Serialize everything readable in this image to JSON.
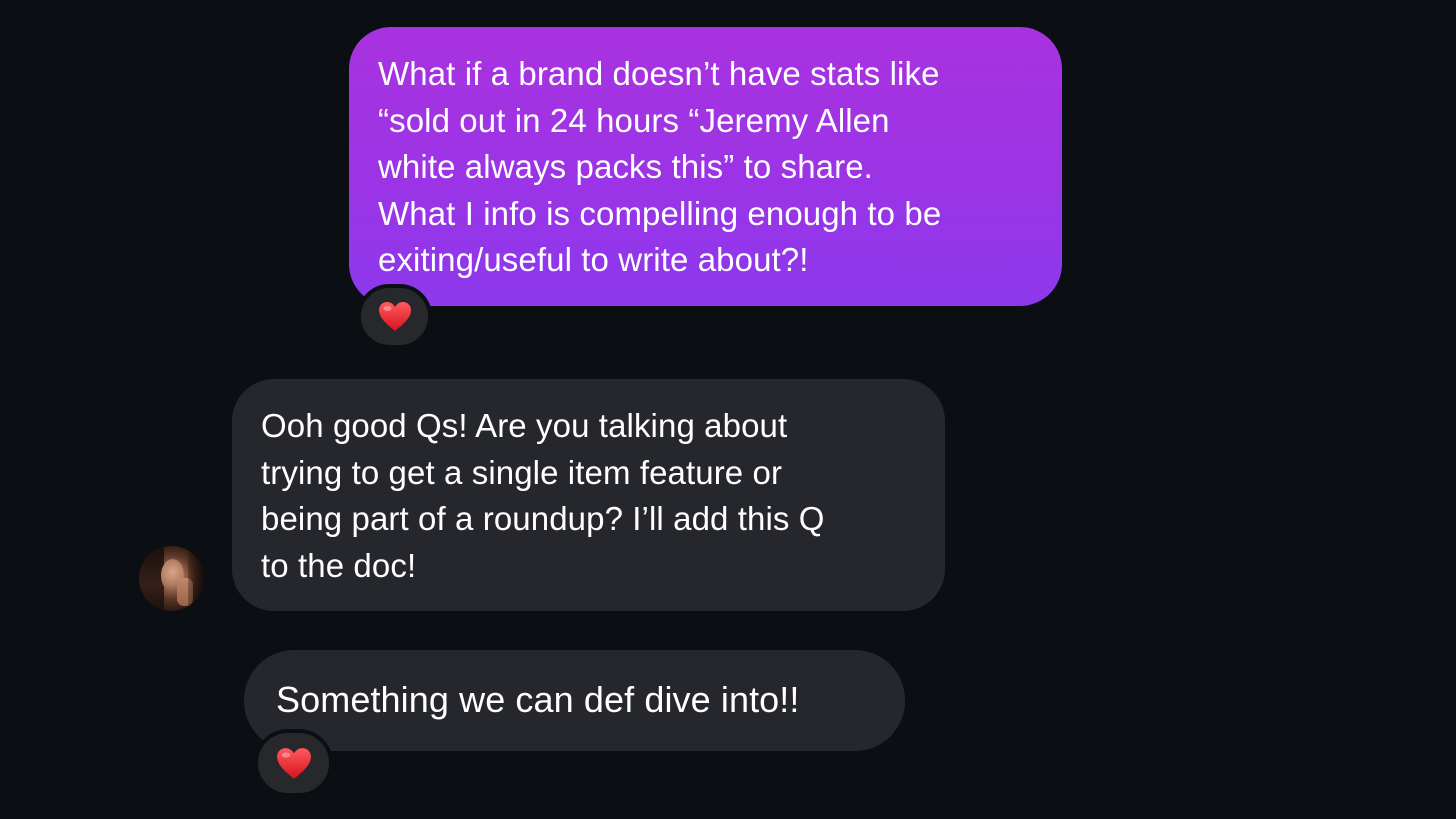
{
  "messages": [
    {
      "direction": "outgoing",
      "lines": [
        "What if a brand doesn’t have stats like",
        "“sold out in 24 hours “Jeremy Allen",
        "white always packs this” to share.",
        "What I info is compelling enough to be",
        "exiting/useful to write about?!"
      ],
      "reaction": "❤️"
    },
    {
      "direction": "incoming",
      "lines": [
        "Ooh good Qs! Are you talking about",
        "trying to get a single item feature or",
        "being part of a roundup? I’ll add this Q",
        "to the doc!"
      ]
    },
    {
      "direction": "incoming",
      "lines": [
        "Something we can def dive into!!"
      ],
      "reaction": "❤️"
    }
  ],
  "colors": {
    "background": "#0b0f13",
    "outgoing_bubble_top": "#a932df",
    "outgoing_bubble_bottom": "#8c38ec",
    "incoming_bubble": "#25272c",
    "reaction_heart": "#e3242b"
  },
  "icons": {
    "reaction": "red-heart-icon",
    "sender_avatar": "profile-photo-avatar"
  }
}
